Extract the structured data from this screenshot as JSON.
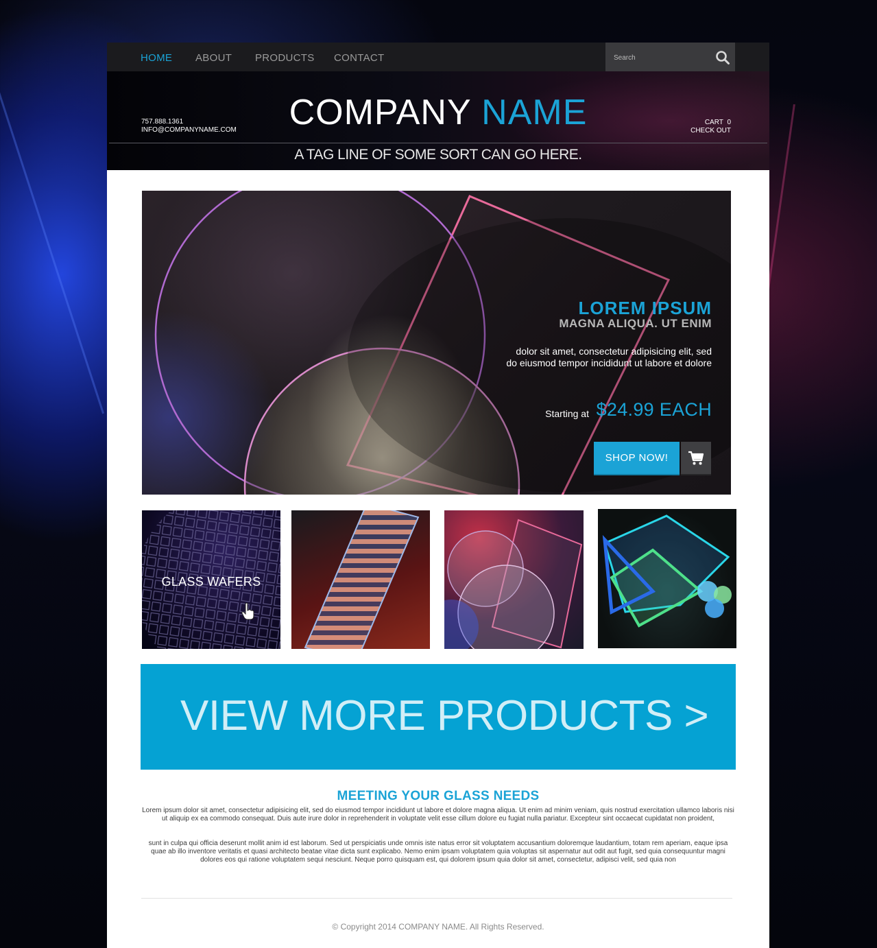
{
  "nav": {
    "items": [
      {
        "label": "HOME",
        "active": true
      },
      {
        "label": "ABOUT",
        "active": false
      },
      {
        "label": "PRODUCTS",
        "active": false
      },
      {
        "label": "CONTACT",
        "active": false
      }
    ],
    "search": {
      "placeholder": "Search",
      "icon": "search-icon"
    }
  },
  "header": {
    "phone": "757.888.1361",
    "email": "INFO@COMPANYNAME.COM",
    "logo_primary": "COMPANY",
    "logo_accent": "NAME",
    "cart_label": "CART",
    "cart_count": "0",
    "checkout_label": "CHECK OUT",
    "tagline": "A TAG LINE OF SOME SORT CAN GO HERE."
  },
  "hero": {
    "title": "LOREM IPSUM",
    "subtitle": "MAGNA ALIQUA. UT ENIM",
    "description": "dolor sit amet, consectetur adipisicing elit, sed do eiusmod tempor incididunt ut labore et dolore",
    "price_label": "Starting at",
    "price": "$24.99 EACH",
    "cta_label": "SHOP NOW!",
    "cart_icon": "shopping-cart-icon"
  },
  "tiles": [
    {
      "label": "GLASS WAFERS",
      "hover": true,
      "cursor_icon": "hand-pointer-icon"
    },
    {
      "label": ""
    },
    {
      "label": ""
    },
    {
      "label": ""
    }
  ],
  "view_more": {
    "label": "VIEW MORE PRODUCTS >"
  },
  "about": {
    "title": "MEETING YOUR GLASS NEEDS",
    "paragraph1": "Lorem ipsum dolor sit amet, consectetur adipisicing elit, sed do eiusmod tempor incididunt ut labore et dolore magna aliqua. Ut enim ad minim veniam, quis nostrud exercitation ullamco laboris nisi ut aliquip ex ea commodo consequat. Duis aute irure dolor in reprehenderit in voluptate velit esse cillum dolore eu fugiat nulla pariatur. Excepteur sint occaecat cupidatat non proident,",
    "paragraph2": "sunt in culpa qui officia deserunt mollit anim id est laborum. Sed ut perspiciatis unde omnis iste natus error sit voluptatem accusantium doloremque laudantium, totam rem aperiam, eaque ipsa quae ab illo inventore veritatis et quasi architecto beatae vitae dicta sunt explicabo. Nemo enim ipsam voluptatem quia voluptas sit aspernatur aut odit aut fugit, sed quia consequuntur magni dolores eos qui ratione voluptatem sequi nesciunt. Neque porro quisquam est, qui dolorem ipsum quia dolor sit amet, consectetur, adipisci velit, sed quia non"
  },
  "footer": {
    "copyright": "© Copyright 2014 COMPANY NAME. All Rights Reserved."
  },
  "colors": {
    "accent": "#1ba3d6",
    "nav_bg": "#1b1b1e",
    "banner_bg": "#05a2d3"
  }
}
